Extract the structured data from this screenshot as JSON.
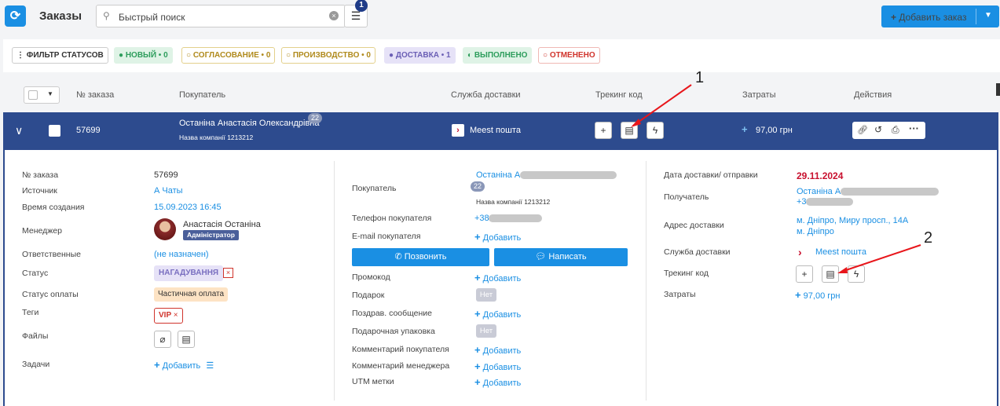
{
  "header": {
    "title": "Заказы",
    "search_placeholder": "Быстрый поиск",
    "filter_count": "1",
    "add_order": "Добавить заказ"
  },
  "status_filter": {
    "filter_label": "ФИЛЬТР СТАТУСОВ",
    "chips": [
      {
        "label": "НОВЫЙ",
        "count": "0",
        "color": "#2d9d5c",
        "bg": "#dff3e6"
      },
      {
        "label": "СОГЛАСОВАНИЕ",
        "count": "0",
        "color": "#b08a1c",
        "bg": "#fff"
      },
      {
        "label": "ПРОИЗВОДСТВО",
        "count": "0",
        "color": "#b08a1c",
        "bg": "#fff"
      },
      {
        "label": "ДОСТАВКА",
        "count": "1",
        "color": "#6b5fb5",
        "bg": "#e6e2f7"
      },
      {
        "label": "ВЫПОЛНЕНО",
        "count": "",
        "color": "#2d9d5c",
        "bg": "#dff3e6"
      },
      {
        "label": "ОТМЕНЕНО",
        "count": "",
        "color": "#d0342c",
        "bg": "#fff"
      }
    ]
  },
  "table": {
    "columns": [
      "№ заказа",
      "Покупатель",
      "Служба доставки",
      "Трекинг код",
      "Затраты",
      "Действия"
    ]
  },
  "order": {
    "number": "57699",
    "buyer_name": "Останіна Анастасія Олександрівна",
    "buyer_badge": "22",
    "buyer_company": "Назва компанії 1213212",
    "delivery": "Meest пошта",
    "cost": "97,00 грн"
  },
  "details_left": {
    "labels": {
      "number": "№ заказа",
      "source": "Источник",
      "created": "Время создания",
      "manager": "Менеджер",
      "responsible": "Ответственные",
      "status": "Статус",
      "payment": "Статус оплаты",
      "tags": "Теги",
      "files": "Файлы",
      "tasks": "Задачи"
    },
    "number": "57699",
    "source": "А Чаты",
    "created": "15.09.2023 16:45",
    "manager_name": "Анастасія Останіна",
    "manager_role": "Адміністратор",
    "responsible": "(не назначен)",
    "status": "НАГАДУВАННЯ",
    "payment": "Частичная оплата",
    "tag": "VIP",
    "add_task": "Добавить"
  },
  "details_mid": {
    "labels": {
      "buyer": "Покупатель",
      "phone": "Телефон покупателя",
      "email": "E-mail покупателя",
      "promo": "Промокод",
      "gift": "Подарок",
      "greeting": "Поздрав. сообщение",
      "gift_wrap": "Подарочная упаковка",
      "buyer_comment": "Комментарий покупателя",
      "manager_comment": "Комментарий менеджера",
      "utm": "UTM метки"
    },
    "buyer_name": "Останіна А",
    "buyer_badge": "22",
    "buyer_company": "Назва компанії 1213212",
    "phone": "+38",
    "add": "Добавить",
    "call": "Позвонить",
    "write": "Написать",
    "no": "Нет"
  },
  "details_right": {
    "labels": {
      "date": "Дата доставки/ отправки",
      "recipient": "Получатель",
      "address": "Адрес доставки",
      "service": "Служба доставки",
      "tracking": "Трекинг код",
      "cost": "Затраты"
    },
    "date": "29.11.2024",
    "recipient_name": "Останіна А",
    "recipient_phone": "+3",
    "address1": "м. Дніпро, Миру просп., 14А",
    "address2": "м. Дніпро",
    "service": "Meest пошта",
    "cost": "97,00 грн"
  },
  "annotations": [
    "1",
    "2"
  ],
  "colors": {
    "accent": "#1a8fe3",
    "row": "#2d4b8e",
    "red": "#c8102e"
  }
}
